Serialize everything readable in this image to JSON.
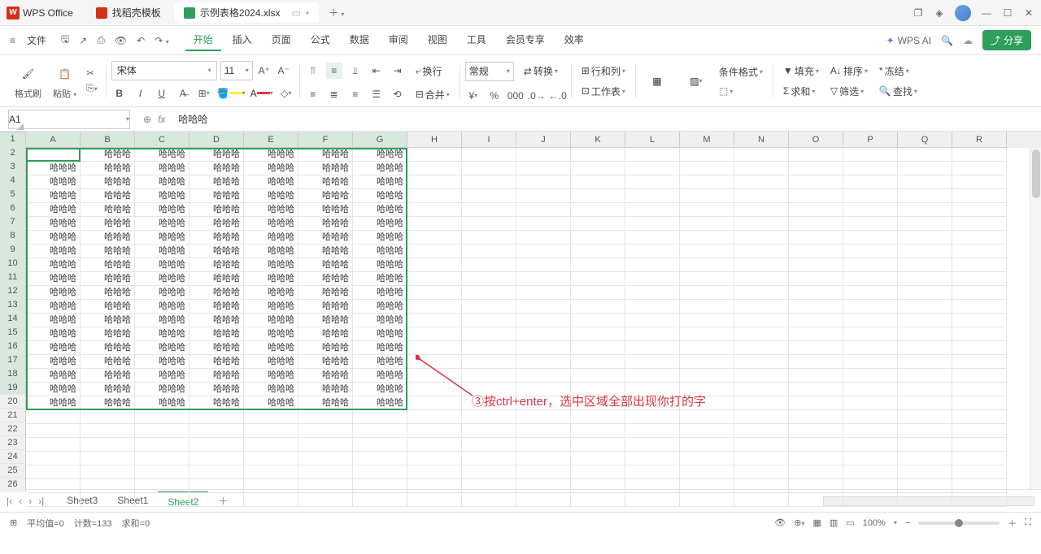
{
  "app": {
    "name": "WPS Office"
  },
  "tabs": [
    {
      "icon": "red",
      "label": "找稻壳模板"
    },
    {
      "icon": "green",
      "label": "示例表格2024.xlsx"
    }
  ],
  "file_menu": "文件",
  "menus": [
    "开始",
    "插入",
    "页面",
    "公式",
    "数据",
    "审阅",
    "视图",
    "工具",
    "会员专享",
    "效率"
  ],
  "active_menu": 0,
  "wps_ai": "WPS AI",
  "share": "分享",
  "toolbar": {
    "format_painter": "格式刷",
    "paste": "粘贴",
    "font_name": "宋体",
    "font_size": "11",
    "number_format": "常规",
    "convert": "转换",
    "rows_cols": "行和列",
    "worksheet": "工作表",
    "cond_fmt": "条件格式",
    "fill": "填充",
    "sort": "排序",
    "freeze": "冻结",
    "sum": "求和",
    "filter": "筛选",
    "find": "查找",
    "wrap": "换行",
    "merge": "合并"
  },
  "namebox": "A1",
  "formula": "哈哈哈",
  "columns": [
    "A",
    "B",
    "C",
    "D",
    "E",
    "F",
    "G",
    "H",
    "I",
    "J",
    "K",
    "L",
    "M",
    "N",
    "O",
    "P",
    "Q",
    "R"
  ],
  "sel_cols": 7,
  "rows": 26,
  "sel_rows": 19,
  "cell_value": "哈哈哈",
  "annotation": "③按ctrl+enter，选中区域全部出现你打的字",
  "sheets": [
    "Sheet3",
    "Sheet1",
    "Sheet2"
  ],
  "active_sheet": 2,
  "status": {
    "avg": "平均值=0",
    "count": "计数=133",
    "sum": "求和=0",
    "zoom": "100%"
  }
}
